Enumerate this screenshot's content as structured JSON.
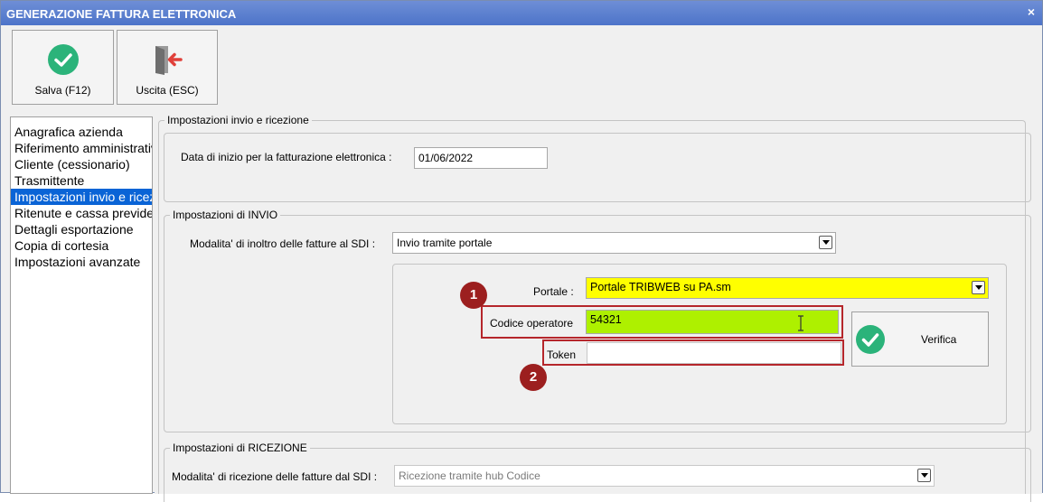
{
  "window": {
    "title": "GENERAZIONE FATTURA ELETTRONICA",
    "close_glyph": "×"
  },
  "toolbar": {
    "save_label": "Salva (F12)",
    "exit_label": "Uscita (ESC)"
  },
  "sidebar": {
    "items": [
      {
        "label": "Anagrafica azienda",
        "selected": false
      },
      {
        "label": "Riferimento amministrativo",
        "selected": false
      },
      {
        "label": "Cliente (cessionario)",
        "selected": false
      },
      {
        "label": "Trasmittente",
        "selected": false
      },
      {
        "label": "Impostazioni invio e ricezione",
        "selected": true
      },
      {
        "label": "Ritenute e cassa previdenziale",
        "selected": false
      },
      {
        "label": "Dettagli esportazione",
        "selected": false
      },
      {
        "label": "Copia di cortesia",
        "selected": false
      },
      {
        "label": "Impostazioni avanzate",
        "selected": false
      }
    ]
  },
  "general": {
    "legend": "Impostazioni invio e ricezione",
    "start_date_label": "Data di inizio per la fatturazione elettronica :",
    "start_date_value": "01/06/2022"
  },
  "send": {
    "legend": "Impostazioni di INVIO",
    "mode_label": "Modalita' di inoltro delle fatture al SDI :",
    "mode_value": "Invio tramite portale",
    "portal_label": "Portale :",
    "portal_value": "Portale TRIBWEB su PA.sm",
    "operator_code_label": "Codice operatore",
    "operator_code_value": "54321",
    "token_label": "Token",
    "token_value": "",
    "verify_label": "Verifica"
  },
  "receive": {
    "legend": "Impostazioni di RICEZIONE",
    "mode_label": "Modalita' di ricezione delle fatture dal SDI :",
    "mode_value": "Ricezione tramite hub Codice"
  },
  "markers": {
    "first": "1",
    "second": "2"
  },
  "colors": {
    "title_bar": "#5a7fcf",
    "selection": "#0a64d6",
    "portal_field": "#ffff00",
    "operator_field": "#aef000",
    "highlight_box": "#b5262b",
    "marker": "#9c1f1f",
    "check_icon": "#2bb37a"
  }
}
